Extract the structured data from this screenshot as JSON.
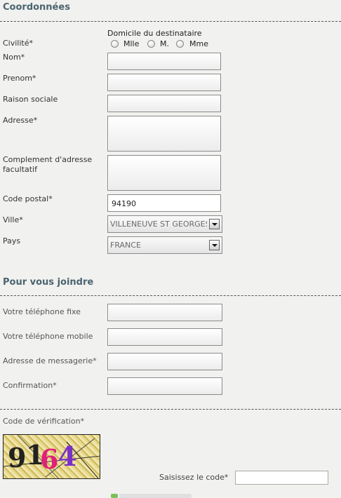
{
  "sections": {
    "coordonnees": {
      "title": "Coordonnées"
    },
    "joindre": {
      "title": "Pour vous joindre"
    }
  },
  "civilite": {
    "label": "Civilité*",
    "group_label": "Domicile du destinataire",
    "options": [
      "Mlle",
      "M.",
      "Mme"
    ]
  },
  "fields": {
    "nom": {
      "label": "Nom*"
    },
    "prenom": {
      "label": "Prenom*"
    },
    "raison_sociale": {
      "label": "Raison sociale"
    },
    "adresse": {
      "label": "Adresse*"
    },
    "complement": {
      "label_line1": "Complement d'adresse",
      "label_line2": "facultatif"
    },
    "code_postal": {
      "label": "Code postal*",
      "value": "94190"
    },
    "ville": {
      "label": "Ville*",
      "selected": "VILLENEUVE ST GEORGES"
    },
    "pays": {
      "label": "Pays",
      "selected": "FRANCE"
    }
  },
  "contact": {
    "tel_fixe": {
      "label": "Votre téléphone fixe"
    },
    "tel_mobile": {
      "label": "Votre téléphone mobile"
    },
    "email": {
      "label": "Adresse de messagerie*"
    },
    "confirmation": {
      "label": "Confirmation*"
    }
  },
  "verification": {
    "label": "Code de vérification*",
    "captcha_text": "9164",
    "code_prompt": "Saisissez le code*"
  },
  "colors": {
    "section_title": "#4a6470",
    "background": "#f1f1ef"
  }
}
